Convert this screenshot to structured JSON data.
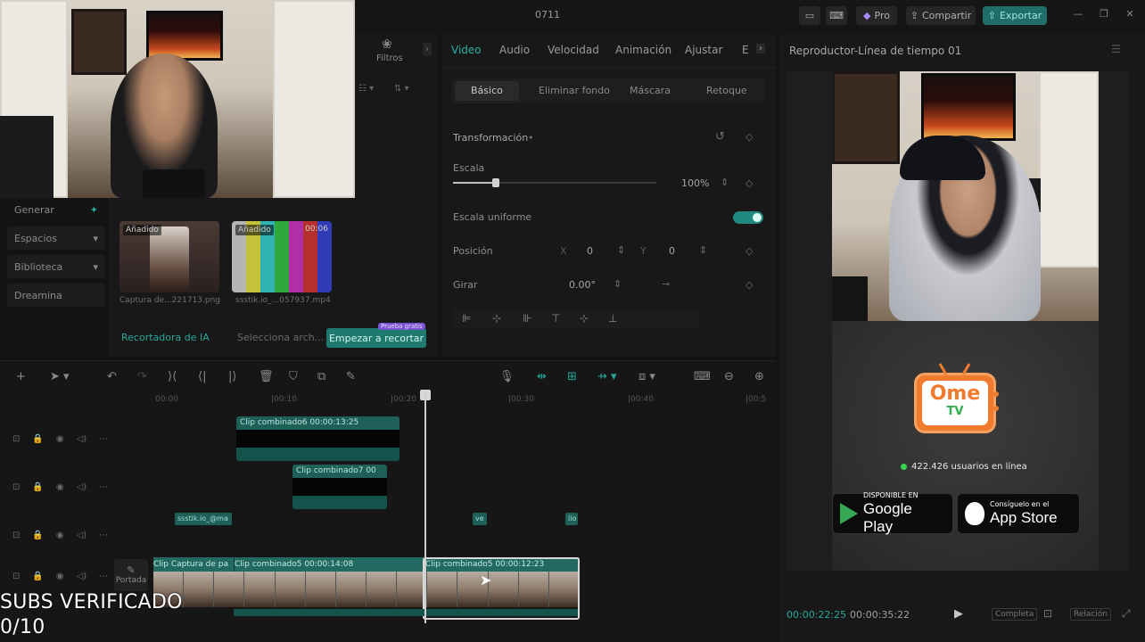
{
  "titlebar": {
    "title": "0711",
    "pro_label": "Pro",
    "share_label": "Compartir",
    "export_label": "Exportar"
  },
  "left_sidebar": {
    "items": [
      {
        "label": "Generar"
      },
      {
        "label": "Espacios"
      },
      {
        "label": "Biblioteca"
      },
      {
        "label": "Dreamina"
      }
    ]
  },
  "filters": {
    "label": "Filtros"
  },
  "media": {
    "thumbs": [
      {
        "tag": "Añadido",
        "duration": "",
        "caption": "Captura de...221713.png"
      },
      {
        "tag": "Añadido",
        "duration": "00:06",
        "caption": "ssstik.io_...057937.mp4"
      }
    ],
    "ai_recorter_label": "Recortadora de IA",
    "ai_select_label": "Selecciona arch...",
    "ai_button_label": "Empezar a recortar",
    "ai_badge": "Prueba gratis"
  },
  "properties": {
    "tabs": [
      "Video",
      "Audio",
      "Velocidad",
      "Animación",
      "Ajustar",
      "E"
    ],
    "active_tab": "Video",
    "subtabs": [
      "Básico",
      "Eliminar fondo",
      "Máscara",
      "Retoque"
    ],
    "transform_label": "Transformación",
    "scale_label": "Escala",
    "scale_value": "100%",
    "scale_fraction": 0.2,
    "uniform_scale_label": "Escala uniforme",
    "position_label": "Posición",
    "pos_x_label": "X",
    "pos_x": "0",
    "pos_y_label": "Y",
    "pos_y": "0",
    "rotate_label": "Girar",
    "rotate_value": "0.00°"
  },
  "player": {
    "title": "Reproductor-Línea de tiempo 01",
    "current_time": "00:00:22:25",
    "total_time": "00:00:35:22",
    "full_label": "Completa",
    "ratio_label": "Relación",
    "ome": {
      "brand_top": "Ome",
      "brand_bottom": "TV",
      "online_text": "422.426 usuarios en línea",
      "gplay_small": "DISPONIBLE EN",
      "gplay_big": "Google Play",
      "appstore_small": "Consíguelo en el",
      "appstore_big": "App Store"
    }
  },
  "timeline": {
    "ruler": [
      "00:00",
      "|00:10",
      "|00:20",
      "|00:30",
      "|00:40",
      "|00:5"
    ],
    "clips": [
      {
        "label": "Clip combinado6  00:00:13:25"
      },
      {
        "label": "Clip combinado7  00"
      },
      {
        "label": "ssstik.io_@ma"
      },
      {
        "label": "ve"
      },
      {
        "label": "lio"
      }
    ],
    "main_track": {
      "seg1": "Clip  Captura de pa",
      "seg2": "Clip combinado5  00:00:14:08",
      "seg3": "Clip combinado5  00:00:12:23"
    },
    "cover_label": "Portada"
  },
  "subs_overlay": {
    "line1": "SUBS VERIFICADO",
    "line2": "0/10"
  },
  "colors": {
    "accent": "#27b3a4",
    "export": "#1f6f68",
    "ome_orange": "#f07a2d"
  }
}
